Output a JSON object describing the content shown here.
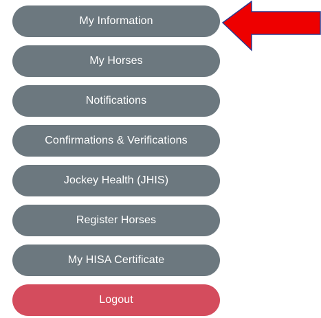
{
  "menu": {
    "items": [
      {
        "label": "My Information"
      },
      {
        "label": "My Horses"
      },
      {
        "label": "Notifications"
      },
      {
        "label": "Confirmations & Verifications"
      },
      {
        "label": "Jockey Health (JHIS)"
      },
      {
        "label": "Register Horses"
      },
      {
        "label": "My HISA Certificate"
      }
    ],
    "logout_label": "Logout"
  },
  "colors": {
    "button_bg": "#6c787f",
    "logout_bg": "#d44c5d",
    "button_text": "#ffffff",
    "arrow_fill": "#ee0000",
    "arrow_stroke": "#2b3a8f"
  },
  "annotation": {
    "icon": "red-arrow-icon",
    "points_to": "My Information"
  }
}
